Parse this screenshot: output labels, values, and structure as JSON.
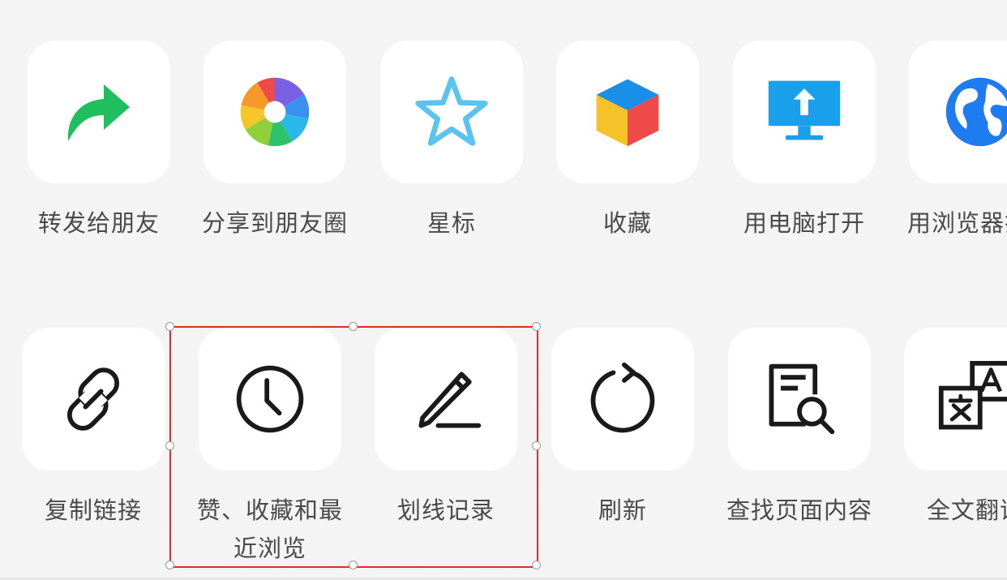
{
  "menu": {
    "row1": [
      {
        "label": "转发给朋友",
        "icon": "forward-arrow-icon"
      },
      {
        "label": "分享到朋友圈",
        "icon": "moments-shutter-icon"
      },
      {
        "label": "星标",
        "icon": "star-icon"
      },
      {
        "label": "收藏",
        "icon": "favorites-cube-icon"
      },
      {
        "label": "用电脑打开",
        "icon": "computer-upload-icon"
      },
      {
        "label": "用浏览器打开",
        "icon": "globe-icon"
      }
    ],
    "row2": [
      {
        "label": "复制链接",
        "icon": "link-icon"
      },
      {
        "label": "赞、收藏和最近浏览",
        "icon": "clock-icon"
      },
      {
        "label": "划线记录",
        "icon": "pencil-underline-icon"
      },
      {
        "label": "刷新",
        "icon": "refresh-icon"
      },
      {
        "label": "查找页面内容",
        "icon": "document-search-icon"
      },
      {
        "label": "全文翻译",
        "icon": "translate-icon"
      }
    ]
  },
  "colors": {
    "background": "#f4f4f4",
    "tile": "#ffffff",
    "label_text": "#4a4a4a",
    "selection_border": "#e02a2a",
    "forward_green": "#1fbf5f",
    "star_blue": "#5bc4ee",
    "computer_blue": "#1aa0ea",
    "globe_blue": "#1f7cf0"
  }
}
